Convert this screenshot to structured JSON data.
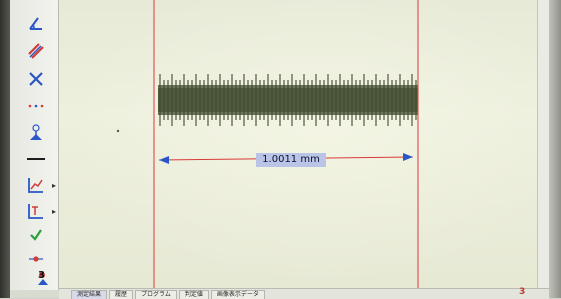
{
  "measurement": {
    "value_text": "1.0011 mm"
  },
  "toolbar": {
    "tools": [
      {
        "name": "angle-tool-icon"
      },
      {
        "name": "parallel-lines-tool-icon"
      },
      {
        "name": "cross-point-tool-icon"
      },
      {
        "name": "dotted-line-tool-icon"
      },
      {
        "name": "perpendicular-tool-icon"
      },
      {
        "name": "line-tool-icon"
      },
      {
        "name": "graph-tool-icon"
      },
      {
        "name": "ruler-tool-icon"
      },
      {
        "name": "check-icon"
      },
      {
        "name": "point-tool-icon"
      }
    ],
    "sample_label": "3"
  },
  "tabs": [
    {
      "label": "測定結果"
    },
    {
      "label": "履歴"
    },
    {
      "label": "プログラム"
    },
    {
      "label": "判定値"
    },
    {
      "label": "画像表示データ"
    }
  ],
  "status": {
    "corner_number": "3"
  },
  "colors": {
    "guide_line": "#e04848",
    "dimension_line": "#d83a3a",
    "arrow": "#2a56c8",
    "label_bg": "#b9c4e6",
    "specimen": "#4f5a3d"
  }
}
